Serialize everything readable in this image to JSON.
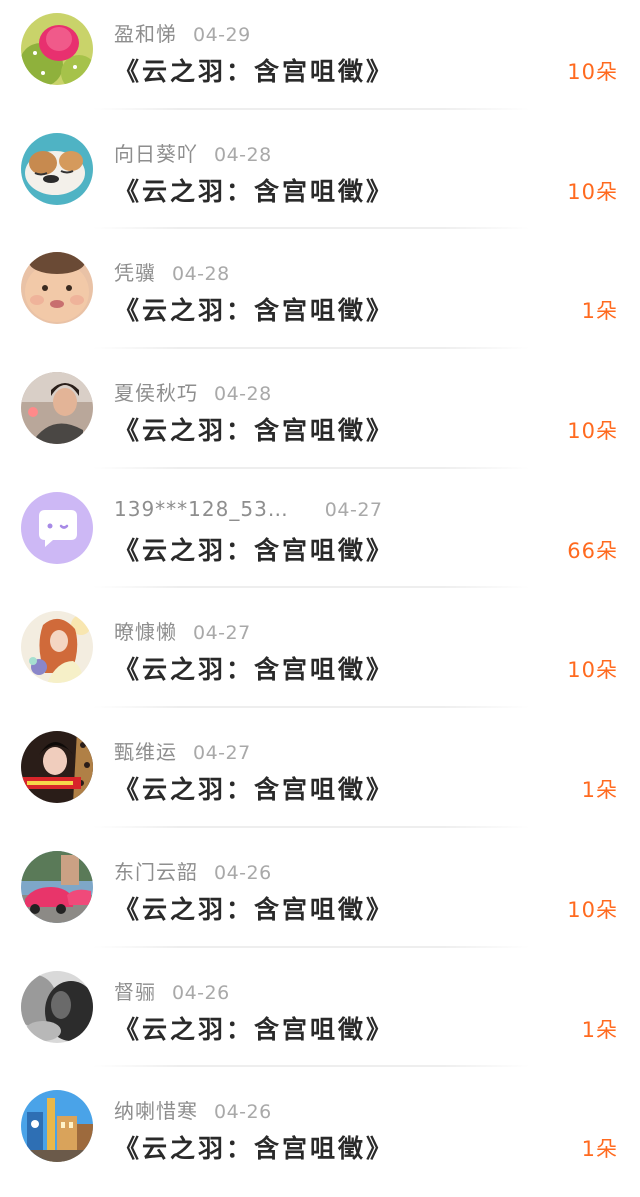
{
  "items": [
    {
      "name": "盈和悌",
      "date": "04-29",
      "title": "《云之羽：含宫咀徵》",
      "amount": "10朵"
    },
    {
      "name": "向日葵吖",
      "date": "04-28",
      "title": "《云之羽：含宫咀徵》",
      "amount": "10朵"
    },
    {
      "name": "凭骥",
      "date": "04-28",
      "title": "《云之羽：含宫咀徵》",
      "amount": "1朵"
    },
    {
      "name": "夏侯秋巧",
      "date": "04-28",
      "title": "《云之羽：含宫咀徵》",
      "amount": "10朵"
    },
    {
      "name": "139***128_53…",
      "date": "04-27",
      "title": "《云之羽：含宫咀徵》",
      "amount": "66朵"
    },
    {
      "name": "暸慷懒",
      "date": "04-27",
      "title": "《云之羽：含宫咀徵》",
      "amount": "10朵"
    },
    {
      "name": "甄维运",
      "date": "04-27",
      "title": "《云之羽：含宫咀徵》",
      "amount": "1朵"
    },
    {
      "name": "东门云韶",
      "date": "04-26",
      "title": "《云之羽：含宫咀徵》",
      "amount": "10朵"
    },
    {
      "name": "督骊",
      "date": "04-26",
      "title": "《云之羽：含宫咀徵》",
      "amount": "1朵"
    },
    {
      "name": "纳喇惜寒",
      "date": "04-26",
      "title": "《云之羽：含宫咀徵》",
      "amount": "1朵"
    }
  ],
  "avatar_icons": [
    "cactus-flower-avatar-icon",
    "sleeping-dog-avatar-icon",
    "baby-face-avatar-icon",
    "woman-photo-avatar-icon",
    "default-chat-avatar-icon",
    "illustrated-girl-avatar-icon",
    "woman-selfie-avatar-icon",
    "pink-car-avatar-icon",
    "monochrome-portrait-avatar-icon",
    "city-street-avatar-icon"
  ],
  "colors": {
    "amount": "#ff6a1f",
    "name": "#8e8e8e",
    "date": "#a9a9a9",
    "title": "#2a2a2a",
    "default_avatar": "#cdb8f5"
  }
}
